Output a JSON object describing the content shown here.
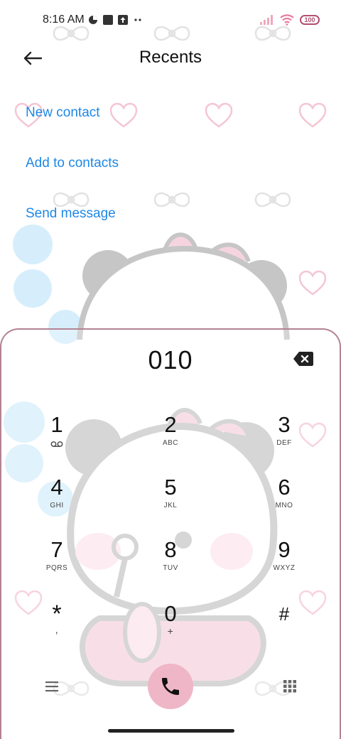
{
  "status_bar": {
    "time": "8:16 AM",
    "battery": "100"
  },
  "header": {
    "title": "Recents"
  },
  "actions": {
    "new_contact": "New contact",
    "add_to_contacts": "Add to contacts",
    "send_message": "Send message"
  },
  "dialer": {
    "number": "010",
    "keys": [
      {
        "digit": "1",
        "sub": "oo"
      },
      {
        "digit": "2",
        "sub": "ABC"
      },
      {
        "digit": "3",
        "sub": "DEF"
      },
      {
        "digit": "4",
        "sub": "GHI"
      },
      {
        "digit": "5",
        "sub": "JKL"
      },
      {
        "digit": "6",
        "sub": "MNO"
      },
      {
        "digit": "7",
        "sub": "PQRS"
      },
      {
        "digit": "8",
        "sub": "TUV"
      },
      {
        "digit": "9",
        "sub": "WXYZ"
      },
      {
        "digit": "*",
        "sub": ","
      },
      {
        "digit": "0",
        "sub": "+"
      },
      {
        "digit": "#",
        "sub": ""
      }
    ]
  },
  "icons": {
    "back": "back-arrow-icon",
    "backspace": "backspace-icon",
    "call": "phone-icon",
    "menu": "menu-icon",
    "keypad": "keypad-icon",
    "voicemail": "voicemail-icon"
  },
  "colors": {
    "accent_blue": "#1e88e5",
    "call_button": "#efb6c8",
    "panel_border": "#b38393"
  }
}
